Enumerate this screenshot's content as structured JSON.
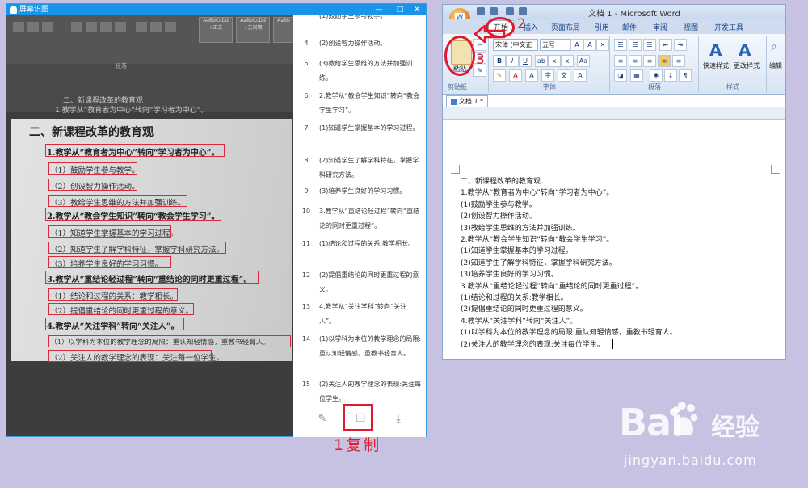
{
  "ocr_window": {
    "title": "屏幕识图",
    "win_buttons": [
      "—",
      "□",
      "✕"
    ],
    "scan": {
      "ribbon_styles": [
        "AaBbCcDd",
        "AaBbCcDd",
        "AaBb"
      ],
      "ribbon_style_names": [
        "+正文",
        "+无间隔",
        ""
      ],
      "ribbon_group": "段落",
      "doc_lines": [
        "二、新课程改革的教育观",
        "1.教学从“教育者为中心”转向“学习者为中心”。"
      ],
      "heading": "二、新课程改革的教育观",
      "lines": [
        "1.教学从“教育者为中心”转向“学习者为中心”。",
        "（1）鼓励学生参与教学。",
        "（2）创设智力操作活动。",
        "（3）教给学生思维的方法并加强训练。",
        "2.教学从“教会学生知识”转向“教会学生学习”。",
        "（1）知道学生掌握基本的学习过程。",
        "（2）知道学生了解学科特征，掌握学科研究方法。",
        "（3）培养学生良好的学习习惯。",
        "3.教学从“重结论轻过程”转向“重结论的同时更重过程”。",
        "（1）结论和过程的关系：教学相长。",
        "（2）提倡重结论的同时更重过程的意义。",
        "4.教学从“关注学科”转向“关注人”。",
        "（1）以学科为本位的教学理念的局限：重认知轻情感，重教书轻育人。",
        "（2）关注人的教学理念的表现：关注每一位学生。"
      ]
    },
    "results": [
      {
        "num": "",
        "text": "(1)鼓励学生参与教学。"
      },
      {
        "num": "4",
        "text": "(2)创设智力操作活动。"
      },
      {
        "num": "5",
        "text": "(3)教给学生思维的方法并加强训练。"
      },
      {
        "num": "6",
        "text": "2.教学从“教会学生知识”转向“教会学生学习”。"
      },
      {
        "num": "7",
        "text": "(1)知道学生掌握基本的学习过程。"
      },
      {
        "num": "8",
        "text": "(2)知道学生了解学科特征，掌握学科研究方法。"
      },
      {
        "num": "9",
        "text": "(3)培养学生良好的学习习惯。"
      },
      {
        "num": "10",
        "text": "3.教学从“重结论轻过程”转向“重结论的同时更重过程”。"
      },
      {
        "num": "11",
        "text": "(1)结论和过程的关系:教学相长。"
      },
      {
        "num": "12",
        "text": "(2)提倡重结论的同时更重过程的意义。"
      },
      {
        "num": "13",
        "text": "4.教学从“关注学科”转向“关注人”。"
      },
      {
        "num": "14",
        "text": "(1)以学科为本位的教学理念的局限:重认知轻情感，重教书轻育人。"
      },
      {
        "num": "15",
        "text": "(2)关注人的教学理念的表现:关注每位学生。"
      }
    ],
    "footer_icons": [
      "edit-icon",
      "copy-icon",
      "download-icon"
    ]
  },
  "annotations": {
    "copy_caption": "1复制",
    "num2": "2",
    "num3": "3",
    "color": "#e0192e"
  },
  "word": {
    "title": "文档 1 - Microsoft Word",
    "orb_glyph": "W",
    "tabs": [
      "开始",
      "插入",
      "页面布局",
      "引用",
      "邮件",
      "审阅",
      "视图",
      "开发工具"
    ],
    "active_tab": "开始",
    "groups": {
      "clipboard": "剪贴板",
      "paste": "粘贴",
      "font": "字体",
      "paragraph": "段落",
      "styles": "样式",
      "editing": "编辑"
    },
    "font_name": "宋体 (中文正",
    "font_size": "五号",
    "style_buttons": [
      "快速样式",
      "更改样式"
    ],
    "doc_tab": "文档 1 *",
    "content": [
      "二、新课程改革的教育观",
      "1.教学从“教育者为中心”转向“学习者为中心”。",
      "(1)鼓励学生参与教学。",
      "(2)创设智力操作活动。",
      "(3)教给学生思维的方法并加强训练。",
      "2.教学从“教会学生知识”转向“教会学生学习”。",
      "(1)知道学生掌握基本的学习过程。",
      "(2)知道学生了解学科特征，掌握学科研究方法。",
      "(3)培养学生良好的学习习惯。",
      "3.教学从“重结论轻过程”转向“重结论的同时更重过程”。",
      "(1)结论和过程的关系:教学相长。",
      "(2)提倡重结论的同时更重过程的意义。",
      "4.教学从“关注学科”转向“关注人”。",
      "(1)以学科为本位的教学理念的局限:重认知轻情感，重教书轻育人。",
      "(2)关注人的教学理念的表现:关注每位学生。"
    ]
  },
  "watermark": {
    "logo": "Bai",
    "logo_suffix": "经验",
    "url": "jingyan.baidu.com"
  }
}
